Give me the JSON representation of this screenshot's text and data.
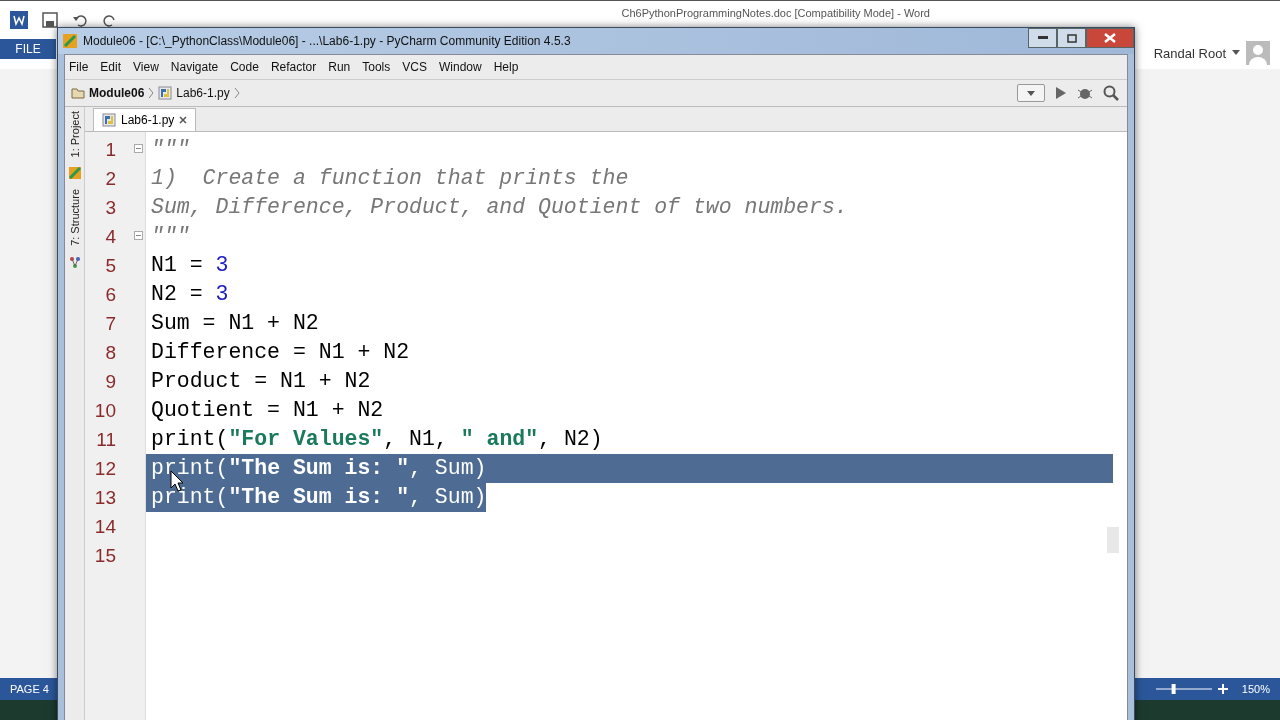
{
  "word": {
    "title": "Ch6PythonProgrammingNotes.doc [Compatibility Mode] - Word",
    "file_tab": "FILE",
    "user": "Randal Root",
    "status_page": "PAGE 4",
    "zoom": "150%",
    "zoom_slider": {
      "level": 0.3
    }
  },
  "window": {
    "title": "Module06 - [C:\\_PythonClass\\Module06] - ...\\Lab6-1.py - PyCharm Community Edition 4.5.3"
  },
  "menu": [
    "File",
    "Edit",
    "View",
    "Navigate",
    "Code",
    "Refactor",
    "Run",
    "Tools",
    "VCS",
    "Window",
    "Help"
  ],
  "breadcrumbs": [
    {
      "label": "Module06",
      "kind": "folder"
    },
    {
      "label": "Lab6-1.py",
      "kind": "file"
    }
  ],
  "tabs": [
    {
      "label": "Lab6-1.py",
      "selected": true
    }
  ],
  "tool_windows": [
    {
      "label": "1: Project",
      "kind": "project"
    },
    {
      "label": "7: Structure",
      "kind": "structure"
    }
  ],
  "lines": [
    {
      "number": "1",
      "selected": false,
      "fold": true,
      "segments": [
        {
          "kind": "doc",
          "text": "\"\"\""
        }
      ]
    },
    {
      "number": "2",
      "selected": false,
      "fold": false,
      "segments": [
        {
          "kind": "doc",
          "text": "1)  Create a function that prints the"
        }
      ]
    },
    {
      "number": "3",
      "selected": false,
      "fold": false,
      "segments": [
        {
          "kind": "doc",
          "text": "Sum, Difference, Product, and Quotient of two numbers."
        }
      ]
    },
    {
      "number": "4",
      "selected": false,
      "fold": true,
      "segments": [
        {
          "kind": "doc",
          "text": "\"\"\""
        }
      ]
    },
    {
      "number": "5",
      "selected": false,
      "fold": false,
      "segments": [
        {
          "kind": "plain",
          "text": "N1 = "
        },
        {
          "kind": "number",
          "text": "3"
        }
      ]
    },
    {
      "number": "6",
      "selected": false,
      "fold": false,
      "segments": [
        {
          "kind": "plain",
          "text": "N2 = "
        },
        {
          "kind": "number",
          "text": "3"
        }
      ]
    },
    {
      "number": "7",
      "selected": false,
      "fold": false,
      "segments": [
        {
          "kind": "plain",
          "text": "Sum = N1 + N2"
        }
      ]
    },
    {
      "number": "8",
      "selected": false,
      "fold": false,
      "segments": [
        {
          "kind": "plain",
          "text": "Difference = N1 + N2"
        }
      ]
    },
    {
      "number": "9",
      "selected": false,
      "fold": false,
      "segments": [
        {
          "kind": "plain",
          "text": "Product = N1 + N2"
        }
      ]
    },
    {
      "number": "10",
      "selected": false,
      "fold": false,
      "segments": [
        {
          "kind": "plain",
          "text": "Quotient = N1 + N2"
        }
      ]
    },
    {
      "number": "11",
      "selected": false,
      "fold": false,
      "segments": [
        {
          "kind": "plain",
          "text": "print("
        },
        {
          "kind": "string",
          "text": "\"For Values\""
        },
        {
          "kind": "plain",
          "text": ", N1, "
        },
        {
          "kind": "string",
          "text": "\" and\""
        },
        {
          "kind": "plain",
          "text": ", N2)"
        }
      ]
    },
    {
      "number": "12",
      "selected": true,
      "fold": false,
      "segments": [
        {
          "kind": "plain",
          "text": "print("
        },
        {
          "kind": "string",
          "text": "\"The Sum is: \""
        },
        {
          "kind": "plain",
          "text": ", Sum)"
        }
      ]
    },
    {
      "number": "13",
      "selected": true,
      "fold": false,
      "segments": [
        {
          "kind": "plain",
          "text": "print("
        },
        {
          "kind": "string",
          "text": "\"The Sum is: \""
        },
        {
          "kind": "plain",
          "text": ", Sum)"
        }
      ]
    },
    {
      "number": "14",
      "selected": false,
      "fold": false
    },
    {
      "number": "15",
      "selected": false,
      "fold": false
    }
  ]
}
